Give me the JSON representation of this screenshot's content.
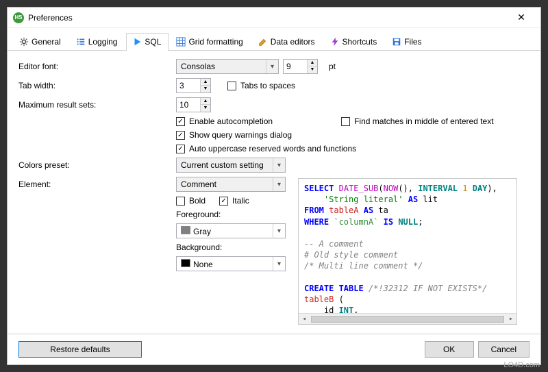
{
  "window": {
    "title": "Preferences"
  },
  "tabs": [
    {
      "label": "General"
    },
    {
      "label": "Logging"
    },
    {
      "label": "SQL"
    },
    {
      "label": "Grid formatting"
    },
    {
      "label": "Data editors"
    },
    {
      "label": "Shortcuts"
    },
    {
      "label": "Files"
    }
  ],
  "labels": {
    "editor_font": "Editor font:",
    "tab_width": "Tab width:",
    "max_result_sets": "Maximum result sets:",
    "pt": "pt",
    "tabs_to_spaces": "Tabs to spaces",
    "enable_autocomplete": "Enable autocompletion",
    "find_matches": "Find matches in middle of entered text",
    "show_query_warnings": "Show query warnings dialog",
    "auto_uppercase": "Auto uppercase reserved words and functions",
    "colors_preset": "Colors preset:",
    "element": "Element:",
    "bold": "Bold",
    "italic": "Italic",
    "foreground": "Foreground:",
    "background": "Background:"
  },
  "values": {
    "font_name": "Consolas",
    "font_size": "9",
    "tab_width": "3",
    "max_result_sets": "10",
    "colors_preset": "Current custom setting",
    "element": "Comment",
    "foreground": "Gray",
    "background": "None"
  },
  "checks": {
    "tabs_to_spaces": false,
    "enable_autocomplete": true,
    "find_matches": false,
    "show_query_warnings": true,
    "auto_uppercase": true,
    "bold": false,
    "italic": true
  },
  "buttons": {
    "restore_defaults": "Restore defaults",
    "ok": "OK",
    "cancel": "Cancel"
  },
  "colors": {
    "foreground_swatch": "#808080",
    "background_swatch": "#000000"
  },
  "watermark": "LO4D.com"
}
